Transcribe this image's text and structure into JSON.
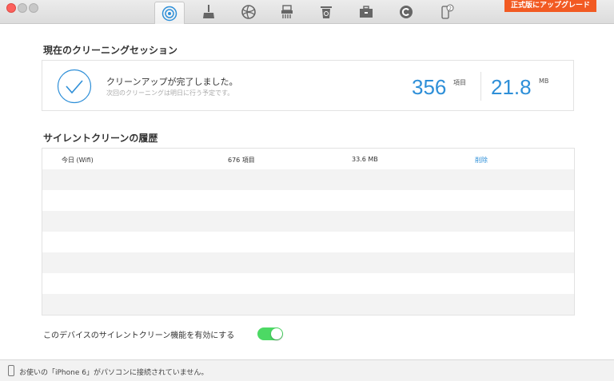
{
  "toolbar": {
    "upgrade_label": "正式版にアップグレード",
    "tools": [
      {
        "icon": "silent-clean-icon",
        "active": true
      },
      {
        "icon": "broom-icon",
        "active": false
      },
      {
        "icon": "globe-icon",
        "active": false
      },
      {
        "icon": "shredder-icon",
        "active": false
      },
      {
        "icon": "trash-icon",
        "active": false
      },
      {
        "icon": "toolbox-icon",
        "active": false
      },
      {
        "icon": "copyright-icon",
        "active": false
      },
      {
        "icon": "device-badge-icon",
        "active": false,
        "badge": "2"
      }
    ]
  },
  "session": {
    "title": "現在のクリーニングセッション",
    "message": "クリーンアップが完了しました。",
    "sub": "次回のクリーニングは明日に行う予定です。",
    "items_value": "356",
    "items_unit": "項目",
    "size_value": "21.8",
    "size_unit": "MB"
  },
  "history": {
    "title": "サイレントクリーンの履歴",
    "rows": [
      {
        "date": "今日 (Wifi)",
        "items": "676 項目",
        "size": "33.6 MB",
        "action": "削除"
      }
    ]
  },
  "toggle": {
    "label": "このデバイスのサイレントクリーン機能を有効にする",
    "enabled": true
  },
  "status": {
    "text": "お使いの「iPhone 6」がパソコンに接続されていません。"
  },
  "colors": {
    "accent": "#2e8fd8",
    "upgrade": "#f25a22",
    "toggle_on": "#4cd964"
  }
}
